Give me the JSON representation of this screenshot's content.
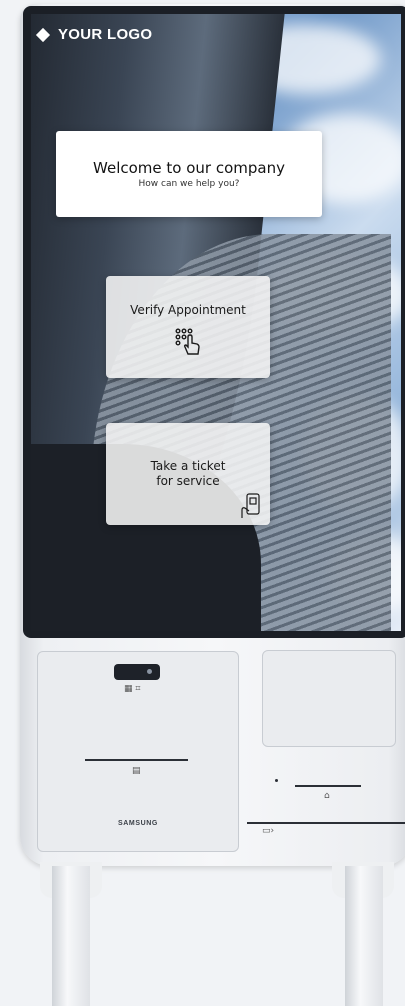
{
  "screen": {
    "logo_text": "YOUR LOGO",
    "welcome": {
      "title": "Welcome to our company",
      "subtitle": "How can we help you?"
    },
    "actions": [
      {
        "label": "Verify Appointment",
        "icon": "touch-keypad-icon"
      },
      {
        "label_line1": "Take a ticket",
        "label_line2": "for service",
        "icon": "phone-qr-icon"
      }
    ]
  },
  "hardware": {
    "brand": "SAMSUNG",
    "scanner_icon": "barcode-scanner-icon",
    "receipt_icon": "receipt-printer-icon",
    "payment_icon": "card-payment-icon",
    "card_slot_icon": "card-slot-icon"
  },
  "colors": {
    "card_bg": "#ffffff",
    "text": "#141414",
    "kiosk_body": "#eef0f3",
    "bezel": "#1b1f26"
  }
}
